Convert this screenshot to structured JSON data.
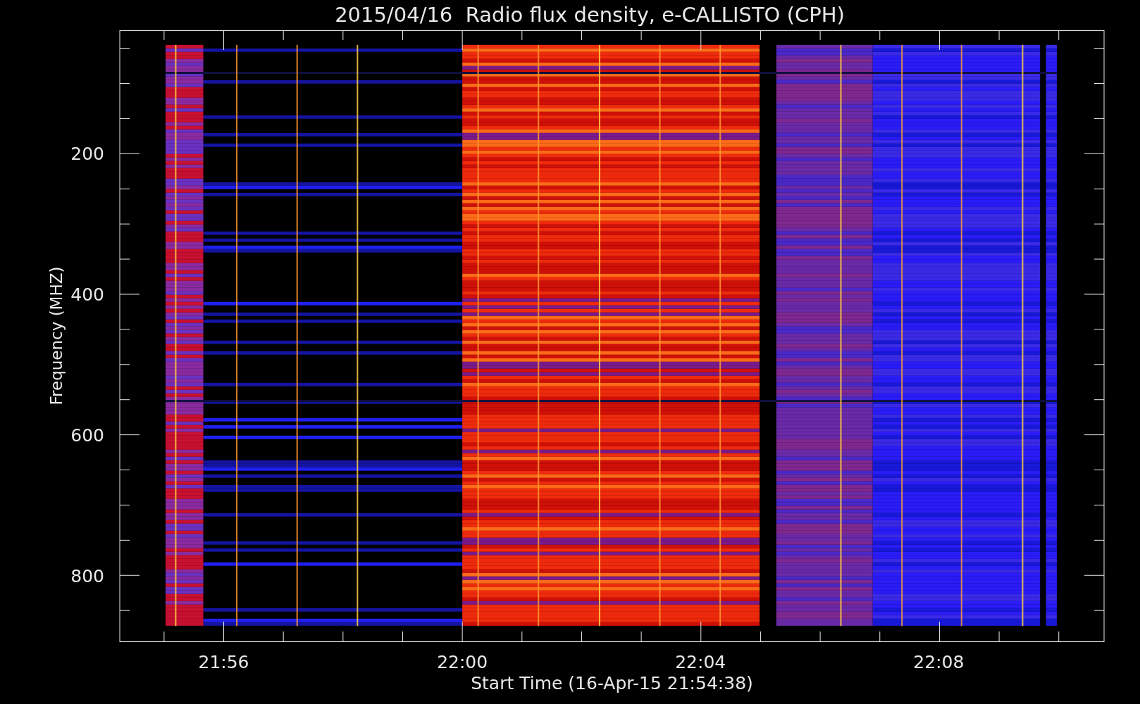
{
  "title": "2015/04/16  Radio flux density, e-CALLISTO (CPH)",
  "y_axis": {
    "label": "Frequency (MHZ)",
    "ticks": [
      "200",
      "400",
      "600",
      "800"
    ]
  },
  "x_axis": {
    "label": "Start Time (16-Apr-15 21:54:38)",
    "ticks": [
      "21:56",
      "22:00",
      "22:04",
      "22:08"
    ]
  }
}
